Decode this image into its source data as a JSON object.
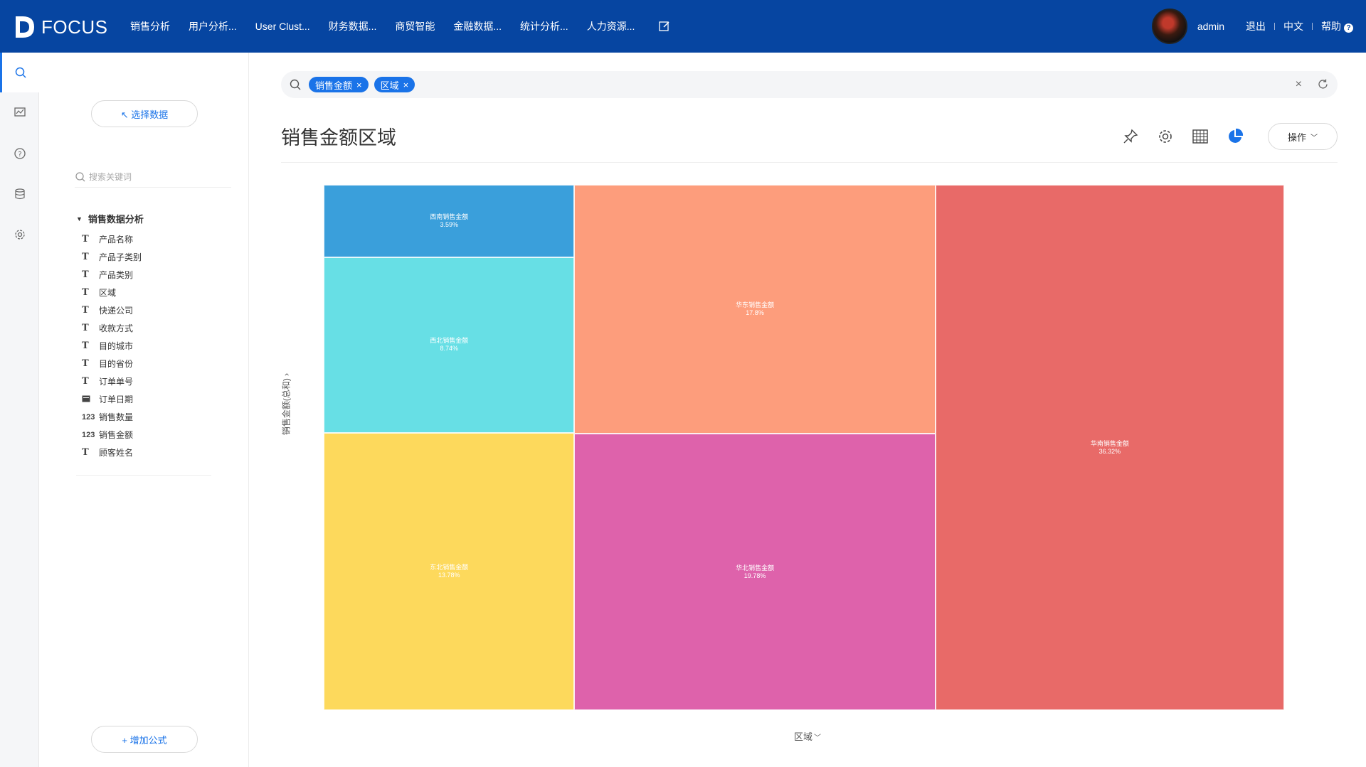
{
  "app": {
    "logo_text": "FOCUS",
    "nav": [
      "销售分析",
      "用户分析...",
      "User Clust...",
      "财务数据...",
      "商贸智能",
      "金融数据...",
      "统计分析...",
      "人力资源..."
    ],
    "user": "admin",
    "logout": "退出",
    "language": "中文",
    "help": "帮助",
    "help_icon": "?"
  },
  "panel": {
    "select_data": "↖ 选择数据",
    "search_placeholder": "搜索关键词",
    "tree_title": "销售数据分析",
    "fields": [
      {
        "icon": "T",
        "label": "产品名称"
      },
      {
        "icon": "T",
        "label": "产品子类别"
      },
      {
        "icon": "T",
        "label": "产品类别"
      },
      {
        "icon": "T",
        "label": "区域"
      },
      {
        "icon": "T",
        "label": "快递公司"
      },
      {
        "icon": "T",
        "label": "收款方式"
      },
      {
        "icon": "T",
        "label": "目的城市"
      },
      {
        "icon": "T",
        "label": "目的省份"
      },
      {
        "icon": "T",
        "label": "订单单号"
      },
      {
        "icon": "cal",
        "label": "订单日期"
      },
      {
        "icon": "123",
        "label": "销售数量"
      },
      {
        "icon": "123",
        "label": "销售金额"
      },
      {
        "icon": "T",
        "label": "顾客姓名"
      }
    ],
    "add_formula": "+ 增加公式"
  },
  "search": {
    "tokens": [
      "销售金额",
      "区域"
    ]
  },
  "answer": {
    "title": "销售金额区域",
    "operations": "操作"
  },
  "chart_data": {
    "type": "treemap",
    "ylabel": "销售金额(总和)",
    "xlabel": "区域",
    "cells": [
      {
        "name": "西南销售金额",
        "pct": 3.59,
        "color": "#3a9fdb"
      },
      {
        "name": "西北销售金额",
        "pct": 8.74,
        "color": "#67dfe5"
      },
      {
        "name": "东北销售金额",
        "pct": 13.78,
        "color": "#fdd95c"
      },
      {
        "name": "华东销售金额",
        "pct": 17.8,
        "color": "#fd9d7c"
      },
      {
        "name": "华北销售金额",
        "pct": 19.78,
        "color": "#de62ab"
      },
      {
        "name": "华南销售金额",
        "pct": 36.32,
        "color": "#e86a68"
      }
    ]
  }
}
